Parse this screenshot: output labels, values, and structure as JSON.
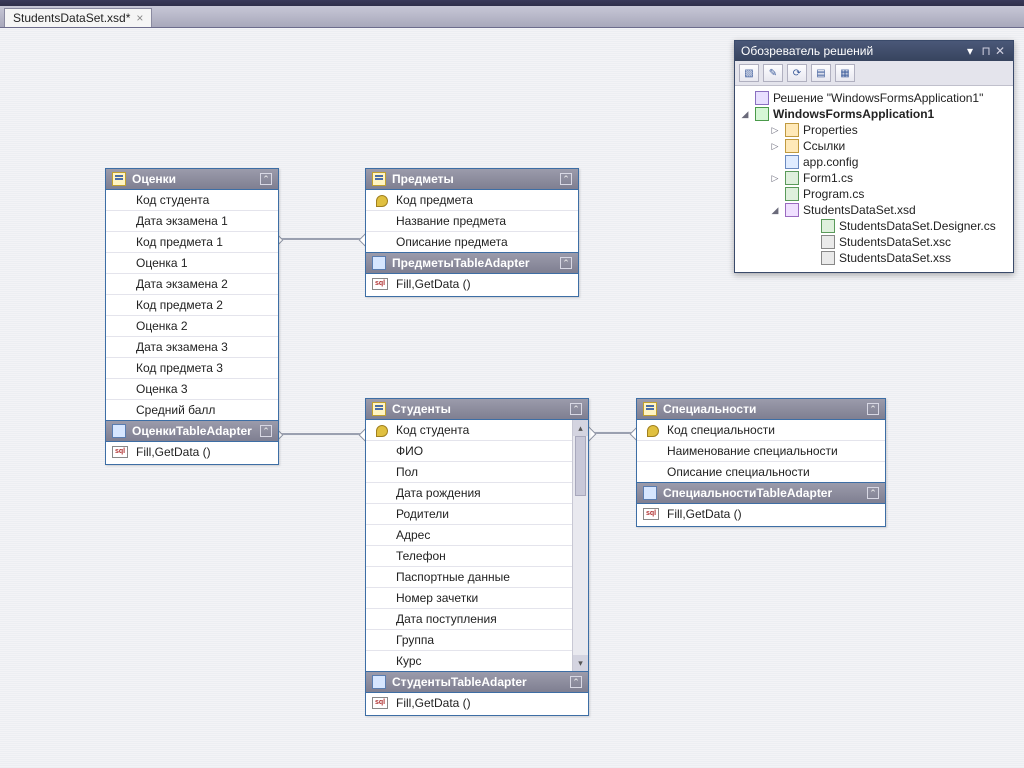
{
  "tab": {
    "label": "StudentsDataSet.xsd*",
    "close": "×"
  },
  "entities": {
    "ocenki": {
      "title": "Оценки",
      "fields": [
        "Код студента",
        "Дата экзамена 1",
        "Код предмета 1",
        "Оценка 1",
        "Дата экзамена 2",
        "Код предмета 2",
        "Оценка 2",
        "Дата экзамена 3",
        "Код предмета 3",
        "Оценка 3",
        "Средний балл"
      ],
      "adapter": "ОценкиTableAdapter",
      "method": "Fill,GetData ()"
    },
    "predmety": {
      "title": "Предметы",
      "fields": [
        "Код предмета",
        "Название предмета",
        "Описание предмета"
      ],
      "key_indices": [
        0
      ],
      "adapter": "ПредметыTableAdapter",
      "method": "Fill,GetData ()"
    },
    "studenty": {
      "title": "Студенты",
      "fields": [
        "Код студента",
        "ФИО",
        "Пол",
        "Дата рождения",
        "Родители",
        "Адрес",
        "Телефон",
        "Паспортные данные",
        "Номер зачетки",
        "Дата поступления",
        "Группа",
        "Курс"
      ],
      "key_indices": [
        0
      ],
      "adapter": "СтудентыTableAdapter",
      "method": "Fill,GetData ()"
    },
    "spec": {
      "title": "Специальности",
      "fields": [
        "Код специальности",
        "Наименование специальности",
        "Описание специальности"
      ],
      "key_indices": [
        0
      ],
      "adapter": "СпециальностиTableAdapter",
      "method": "Fill,GetData ()"
    }
  },
  "solutionExplorer": {
    "title": "Обозреватель решений",
    "nodes": [
      {
        "level": 1,
        "expand": "",
        "icon": "sol",
        "label": "Решение \"WindowsFormsApplication1\"",
        "bold": false
      },
      {
        "level": 1,
        "expand": "◢",
        "icon": "proj",
        "label": "WindowsFormsApplication1",
        "bold": true
      },
      {
        "level": 3,
        "expand": "▷",
        "icon": "fold",
        "label": "Properties",
        "bold": false
      },
      {
        "level": 3,
        "expand": "▷",
        "icon": "fold",
        "label": "Ссылки",
        "bold": false
      },
      {
        "level": 3,
        "expand": "",
        "icon": "cfg",
        "label": "app.config",
        "bold": false
      },
      {
        "level": 3,
        "expand": "▷",
        "icon": "cs",
        "label": "Form1.cs",
        "bold": false
      },
      {
        "level": 3,
        "expand": "",
        "icon": "cs",
        "label": "Program.cs",
        "bold": false
      },
      {
        "level": 3,
        "expand": "◢",
        "icon": "xsd",
        "label": "StudentsDataSet.xsd",
        "bold": false
      },
      {
        "level": 5,
        "expand": "",
        "icon": "cs",
        "label": "StudentsDataSet.Designer.cs",
        "bold": false
      },
      {
        "level": 5,
        "expand": "",
        "icon": "xs",
        "label": "StudentsDataSet.xsc",
        "bold": false
      },
      {
        "level": 5,
        "expand": "",
        "icon": "xs",
        "label": "StudentsDataSet.xss",
        "bold": false
      }
    ]
  },
  "icons": {
    "collapse": "⌃",
    "sql": "sql",
    "pin": "⊓",
    "close": "✕",
    "dropdown": "▾",
    "up": "▴",
    "down": "▾"
  }
}
